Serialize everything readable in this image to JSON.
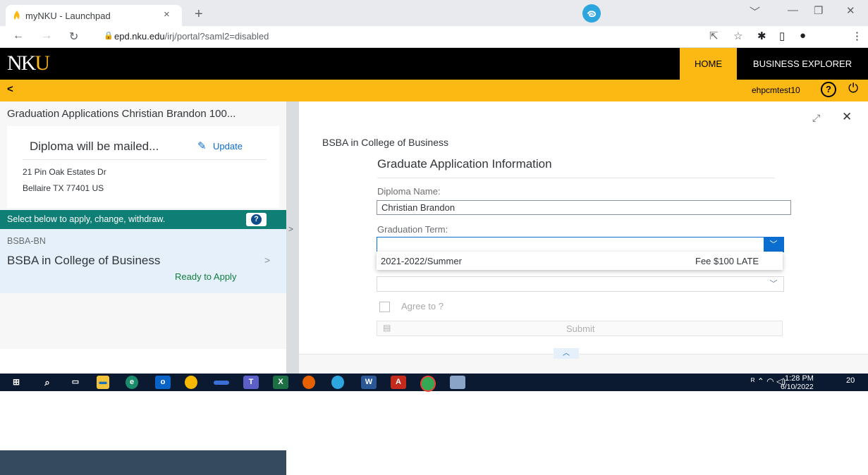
{
  "browser": {
    "tab_title": "myNKU - Launchpad",
    "tab_close": "×",
    "new_tab": "+",
    "url_domain": "epd.nku.edu",
    "url_path": "/irj/portal?saml2=disabled"
  },
  "header": {
    "logo": "NK",
    "logo_flame": "U",
    "nav": {
      "home": "HOME",
      "business_explorer": "BUSINESS EXPLORER"
    }
  },
  "subheader": {
    "back": "<",
    "username": "ehpcmtest10",
    "help": "?",
    "power": "⏻"
  },
  "left_pane": {
    "title": "Graduation Applications Christian Brandon 100...",
    "address_card": {
      "heading": "Diploma will be mailed...",
      "update_label": "Update",
      "line1": "21 Pin Oak Estates Dr",
      "line2": "Bellaire TX 77401 US"
    },
    "instruction": "Select below to apply, change, withdraw.",
    "instruction_help": "?",
    "program": {
      "code": "BSBA-BN",
      "name": "BSBA in College of Business",
      "status": "Ready to Apply"
    }
  },
  "right_pane": {
    "subtitle": "BSBA in College of Business",
    "form": {
      "title": "Graduate Application Information",
      "diploma_name_label": "Diploma Name:",
      "diploma_name_value": "Christian Brandon",
      "graduation_term_label": "Graduation Term:",
      "graduation_term_value": "",
      "dropdown_option": {
        "term": "2021-2022/Summer",
        "fee": "Fee $100 LATE"
      },
      "agree_label": "Agree to ?",
      "submit_label": "Submit"
    }
  },
  "taskbar": {
    "time": "1:28 PM",
    "date": "6/10/2022",
    "notifications": "20"
  },
  "colors": {
    "brand_gold": "#fdb913",
    "header_black": "#000000",
    "teal_bar": "#0f7e74",
    "selected_item_bg": "#e5f0fa",
    "status_green": "#107e3e",
    "link_blue": "#0a6ed1"
  }
}
